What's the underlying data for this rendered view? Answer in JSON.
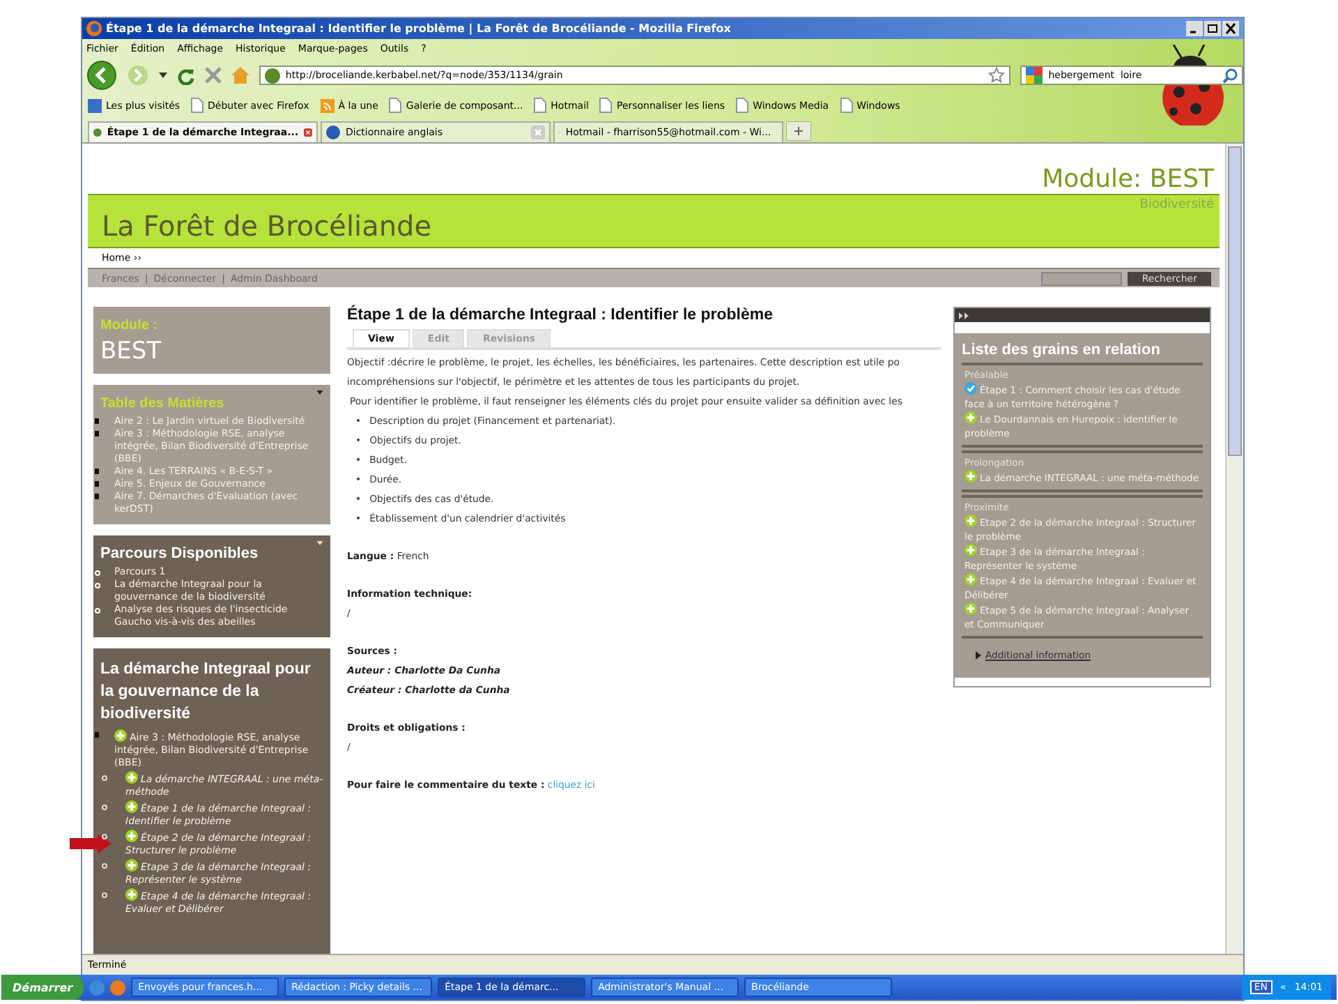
{
  "window": {
    "title": "Étape 1 de la démarche Integraal : Identifier le problème | La Forêt de Brocéliande - Mozilla Firefox"
  },
  "menu": [
    "Fichier",
    "Édition",
    "Affichage",
    "Historique",
    "Marque-pages",
    "Outils",
    "?"
  ],
  "address_bar": {
    "value": "http://broceliande.kerbabel.net/?q=node/353/1134/grain"
  },
  "search": {
    "value": "hebergement  loire"
  },
  "bookmarks": [
    {
      "label": "Les plus visités",
      "kind": "star"
    },
    {
      "label": "Débuter avec Firefox",
      "kind": "page"
    },
    {
      "label": "À la une",
      "kind": "feed"
    },
    {
      "label": "Galerie de composant...",
      "kind": "page"
    },
    {
      "label": "Hotmail",
      "kind": "page"
    },
    {
      "label": "Personnaliser les liens",
      "kind": "page"
    },
    {
      "label": "Windows Media",
      "kind": "page"
    },
    {
      "label": "Windows",
      "kind": "page"
    }
  ],
  "tabs": [
    {
      "label": "Étape 1 de la démarche Integraa...",
      "selected": true
    },
    {
      "label": "Dictionnaire anglais",
      "selected": false
    },
    {
      "label": "Hotmail - fharrison55@hotmail.com - Wi...",
      "selected": false
    }
  ],
  "site": {
    "module": "Module: BEST",
    "title": "La Forêt de Brocéliande",
    "subtitle": "Biodiversité",
    "breadcrumb": "Home ››",
    "user_links": [
      "Frances",
      "Déconnecter",
      "Admin Dashboard"
    ],
    "separator": "|",
    "search_button": "Rechercher"
  },
  "sidebar": [
    {
      "kind": "module",
      "label": "Module :",
      "value": "BEST"
    },
    {
      "kind": "toc",
      "title": "Table des Matières",
      "items": [
        "Aire 2 : Le Jardin virtuel de Biodiversité",
        "Aire 3 : Méthodologie RSE, analyse intégrée, Bilan Biodiversité d'Entreprise (BBE)",
        "Aire 4. Les TERRAINS « B-E-S-T »",
        "Aire 5. Enjeux de Gouvernance",
        "Aire 7. Démarches d'Evaluation (avec kerDST)"
      ]
    },
    {
      "kind": "list",
      "title": "Parcours Disponibles",
      "items": [
        "Parcours 1",
        "La démarche Integraal pour la gouvernance de la biodiversité",
        "Analyse des risques de l'insecticide Gaucho vis-à-vis des abeilles"
      ]
    },
    {
      "kind": "tree",
      "title": "La démarche Integraal pour la gouvernance de la biodiversité",
      "items": [
        {
          "text": "Aire 3 : Méthodologie RSE, analyse intégrée, Bilan Biodiversité d'Entreprise (BBE)",
          "children": [
            {
              "text": "La démarche INTEGRAAL : une méta-méthode"
            },
            {
              "text": "Étape 1 de la démarche Integraal : Identifier le problème"
            },
            {
              "text": "Étape 2 de la démarche Integraal : Structurer le problème"
            },
            {
              "text": "Etape 3 de la démarche Integraal : Représenter le système"
            },
            {
              "text": "Etape 4 de la démarche Integraal : Evaluer et Délibérer"
            }
          ]
        }
      ]
    }
  ],
  "article": {
    "title": "Étape 1 de la démarche Integraal : Identifier le problème",
    "tabs": [
      {
        "label": "View",
        "selected": true
      },
      {
        "label": "Edit",
        "selected": false
      },
      {
        "label": "Revisions",
        "selected": false
      }
    ],
    "paragraphs": [
      "Objectif :décrire le problème, le projet, les échelles, les bénéficiaires, les partenaires. Cette description est utile po",
      "incompréhensions sur l'objectif, le périmètre et les attentes de tous les participants du projet.",
      "Pour identifier le problème, il faut renseigner les éléments clés du projet pour ensuite valider sa définition avec les"
    ],
    "bullet_marker": "•",
    "bullets": [
      "Description du projet (Financement et partenariat).",
      "Objectifs du projet.",
      "Budget.",
      "Durée.",
      "Objectifs des cas d'étude.",
      "Établissement d'un calendrier d'activités"
    ],
    "fields": [
      {
        "kind": "inline",
        "label": "Langue :",
        "value": "French"
      },
      {
        "kind": "block",
        "label": "Information technique:",
        "lines": [
          "/"
        ]
      },
      {
        "kind": "authors",
        "label": "Sources :",
        "lines": [
          "Auteur : Charlotte Da Cunha",
          "Créateur : Charlotte da Cunha"
        ]
      },
      {
        "kind": "block",
        "label": "Droits et obligations :",
        "lines": [
          "/"
        ]
      },
      {
        "kind": "link",
        "label": "Pour faire le commentaire du texte :",
        "value": "cliquez ici"
      }
    ]
  },
  "related": {
    "title": "Liste des grains en relation",
    "sections": [
      {
        "heading": "Préalable",
        "items": [
          {
            "kind": "check",
            "text": "Étape 1 : Comment choisir les cas d'étude face à un territoire hétérogène ?"
          },
          {
            "kind": "plus",
            "text": "Le Dourdannais en Hurepoix : identifier le problème"
          }
        ]
      },
      {
        "heading": "Prolongation",
        "items": [
          {
            "kind": "plus",
            "text": "La démarche INTEGRAAL : une méta-méthode"
          }
        ]
      },
      {
        "heading": "Proximite",
        "items": [
          {
            "kind": "plus",
            "text": "Etape 2 de la démarche Integraal : Structurer le problème"
          },
          {
            "kind": "plus",
            "text": "Etape 3 de la démarche Integraal : Représenter le système"
          },
          {
            "kind": "plus",
            "text": "Etape 4 de la démarche Integraal : Evaluer et Délibérer"
          },
          {
            "kind": "plus",
            "text": "Etape 5 de la démarche Integraal : Analyser et Communiquer"
          }
        ]
      }
    ],
    "more": "Additional information"
  },
  "status_bar": "Terminé",
  "taskbar": {
    "start": "Démarrer",
    "items": [
      {
        "label": "Envoyés pour frances.h...",
        "selected": false
      },
      {
        "label": "Rédaction : Picky details ...",
        "selected": false
      },
      {
        "label": "Étape 1 de la démarc...",
        "selected": true
      },
      {
        "label": "Administrator's Manual ...",
        "selected": false
      },
      {
        "label": "Brocéliande",
        "selected": false
      }
    ],
    "language": "EN",
    "expand": "«",
    "clock": "14:01"
  }
}
